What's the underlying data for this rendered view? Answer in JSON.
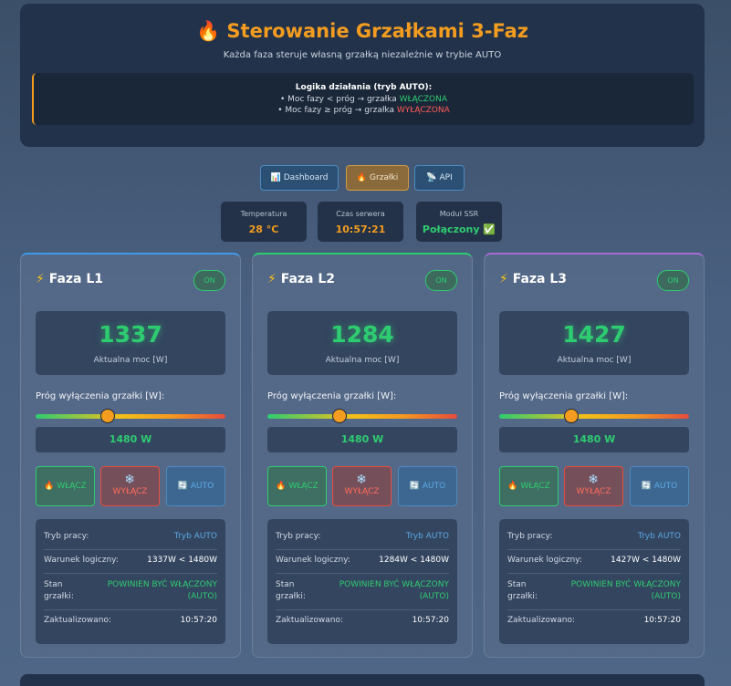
{
  "header": {
    "title_icon": "🔥",
    "title": "Sterowanie Grzałkami 3-Faz",
    "subtitle": "Każda faza steruje własną grzałką niezależnie w trybie AUTO",
    "logic_title": "Logika działania (tryb AUTO):",
    "logic_line1_prefix": "• Moc fazy < próg → grzałka",
    "logic_line1_state": "WŁĄCZONA",
    "logic_line2_prefix": "• Moc fazy ≥ próg → grzałka",
    "logic_line2_state": "WYŁĄCZONA"
  },
  "nav": {
    "dashboard_icon": "📊",
    "dashboard": "Dashboard",
    "grzalki_icon": "🔥",
    "grzalki": "Grzałki",
    "api_icon": "📡",
    "api": "API"
  },
  "status": {
    "temp_label": "Temperatura",
    "temp_value": "28 °C",
    "time_label": "Czas serwera",
    "time_value": "10:57:21",
    "ssr_label": "Moduł SSR",
    "ssr_value": "Połączony ✅"
  },
  "phases": [
    {
      "title": "Faza L1",
      "badge": "ON",
      "power": "1337",
      "power_label": "Aktualna moc [W]",
      "threshold_label": "Próg wyłączenia grzałki [W]:",
      "threshold_fraction": 0.38,
      "threshold_value": "1480 W",
      "btn_on": "🔥 WŁĄCZ",
      "btn_off_icon": "❄️",
      "btn_off": "WYŁĄCZ",
      "btn_auto": "🔄 AUTO",
      "mode_label": "Tryb pracy:",
      "mode_value": "Tryb AUTO",
      "cond_label": "Warunek logiczny:",
      "cond_value": "1337W < 1480W",
      "state_label1": "Stan",
      "state_label2": "grzałki:",
      "state_value1": "POWINIEN BYĆ WŁĄCZONY",
      "state_value2": "(AUTO)",
      "updated_label": "Zaktualizowano:",
      "updated_value": "10:57:20"
    },
    {
      "title": "Faza L2",
      "badge": "ON",
      "power": "1284",
      "power_label": "Aktualna moc [W]",
      "threshold_label": "Próg wyłączenia grzałki [W]:",
      "threshold_fraction": 0.38,
      "threshold_value": "1480 W",
      "btn_on": "🔥 WŁĄCZ",
      "btn_off_icon": "❄️",
      "btn_off": "WYŁĄCZ",
      "btn_auto": "🔄 AUTO",
      "mode_label": "Tryb pracy:",
      "mode_value": "Tryb AUTO",
      "cond_label": "Warunek logiczny:",
      "cond_value": "1284W < 1480W",
      "state_label1": "Stan",
      "state_label2": "grzałki:",
      "state_value1": "POWINIEN BYĆ WŁĄCZONY",
      "state_value2": "(AUTO)",
      "updated_label": "Zaktualizowano:",
      "updated_value": "10:57:20"
    },
    {
      "title": "Faza L3",
      "badge": "ON",
      "power": "1427",
      "power_label": "Aktualna moc [W]",
      "threshold_label": "Próg wyłączenia grzałki [W]:",
      "threshold_fraction": 0.38,
      "threshold_value": "1480 W",
      "btn_on": "🔥 WŁĄCZ",
      "btn_off_icon": "❄️",
      "btn_off": "WYŁĄCZ",
      "btn_auto": "🔄 AUTO",
      "mode_label": "Tryb pracy:",
      "mode_value": "Tryb AUTO",
      "cond_label": "Warunek logiczny:",
      "cond_value": "1427W < 1480W",
      "state_label1": "Stan",
      "state_label2": "grzałki:",
      "state_value1": "POWINIEN BYĆ WŁĄCZONY",
      "state_value2": "(AUTO)",
      "updated_label": "Zaktualizowano:",
      "updated_value": "10:57:20"
    }
  ]
}
